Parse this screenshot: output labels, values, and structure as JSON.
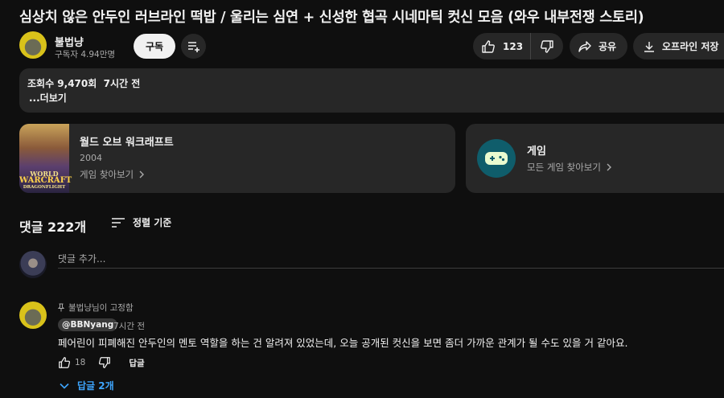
{
  "video": {
    "title": "심상치 않은 안두인 러브라인 떡밥 / 울리는 심연 + 신성한 협곡 시네마틱 컷신 모음 (와우 내부전쟁 스토리)"
  },
  "channel": {
    "name": "불법냥",
    "subscribers": "구독자 4.94만명",
    "subscribe_label": "구독"
  },
  "actions": {
    "like_count": "123",
    "share_label": "공유",
    "download_label": "오프라인 저장"
  },
  "description": {
    "views": "조회수 9,470회",
    "time": "7시간 전",
    "more_label": "...더보기"
  },
  "cards": [
    {
      "title": "월드 오브 워크래프트",
      "year": "2004",
      "link_label": "게임 찾아보기",
      "cover_lines": [
        "WORLD",
        "WARCRAFT",
        "DRAGONFLIGHT"
      ]
    },
    {
      "title": "게임",
      "link_label": "모든 게임 찾아보기"
    }
  ],
  "comments_section": {
    "count_label": "댓글 222개",
    "sort_label": "정렬 기준",
    "add_placeholder": "댓글 추가..."
  },
  "pinned_comment": {
    "pinned_label": "불법냥님이 고정함",
    "author": "@BBNyang",
    "time": "7시간 전",
    "text": "페어린이 피폐해진 안두인의 멘토 역할을 하는 건 알려져 있었는데, 오늘 공개된 컷신을 보면 좀더 가까운 관계가 될 수도 있을 거 같아요.",
    "likes": "18",
    "reply_label": "답글",
    "replies_label": "답글 2개"
  },
  "colors": {
    "background": "#0f0f0f",
    "surface": "#272727",
    "link_blue": "#3ea6ff",
    "game_icon": "#0f5d6b"
  }
}
